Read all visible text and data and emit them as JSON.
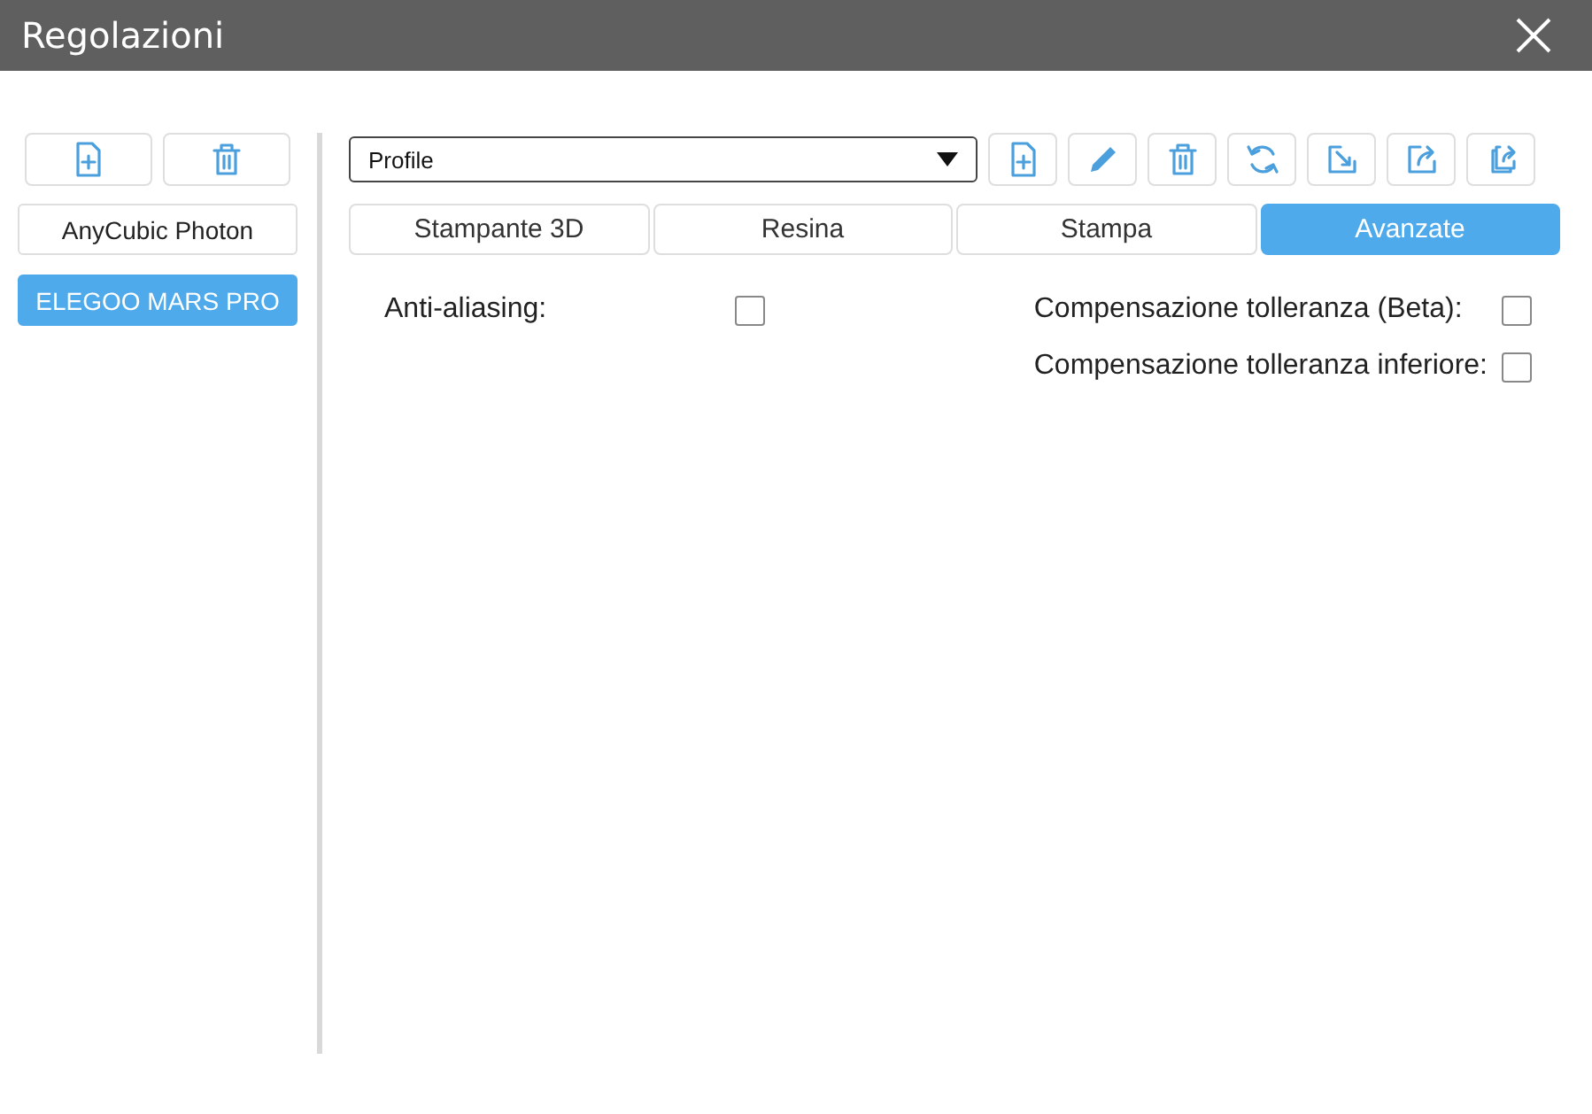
{
  "window": {
    "title": "Regolazioni"
  },
  "sidebar": {
    "tools": [
      {
        "kind": "add"
      },
      {
        "kind": "delete"
      }
    ],
    "items": [
      {
        "label": "AnyCubic Photon",
        "selected": false
      },
      {
        "label": "ELEGOO MARS PRO",
        "selected": true
      }
    ]
  },
  "profile": {
    "value": "Profile"
  },
  "toolbar": [
    {
      "kind": "add"
    },
    {
      "kind": "edit"
    },
    {
      "kind": "delete"
    },
    {
      "kind": "refresh"
    },
    {
      "kind": "import"
    },
    {
      "kind": "export"
    },
    {
      "kind": "share"
    }
  ],
  "tabs": [
    {
      "label": "Stampante 3D",
      "selected": false
    },
    {
      "label": "Resina",
      "selected": false
    },
    {
      "label": "Stampa",
      "selected": false
    },
    {
      "label": "Avanzate",
      "selected": true
    }
  ],
  "options": [
    [
      {
        "label": "Anti-aliasing:",
        "checked": false
      }
    ],
    [
      {
        "label": "Compensazione tolleranza (Beta):",
        "checked": false
      },
      {
        "label": "Compensazione tolleranza inferiore:",
        "checked": false
      }
    ]
  ]
}
